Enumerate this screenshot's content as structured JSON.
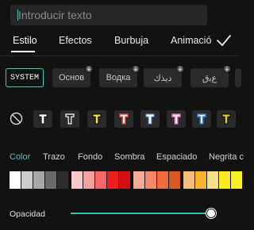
{
  "input": {
    "placeholder": "Introducir texto"
  },
  "tabs": [
    {
      "label": "Estilo"
    },
    {
      "label": "Efectos"
    },
    {
      "label": "Burbuja"
    },
    {
      "label": "Animació"
    }
  ],
  "fonts": [
    {
      "label": "SYSTEM"
    },
    {
      "label": "Основ"
    },
    {
      "label": "Водка"
    },
    {
      "label": "ديذك"
    },
    {
      "label": "ﻉﺑﻕ"
    }
  ],
  "subtabs": [
    {
      "label": "Color"
    },
    {
      "label": "Trazo"
    },
    {
      "label": "Fondo"
    },
    {
      "label": "Sombra"
    },
    {
      "label": "Espaciado"
    },
    {
      "label": "Negrita c"
    }
  ],
  "colors": {
    "accent": "#3ec8c8",
    "swatches": [
      "#ffffff",
      "#cccccc",
      "#a8a8a8",
      "#6a6a6a",
      "#2e2e2e",
      "#f8c7c7",
      "#f7a0a0",
      "#f76767",
      "#ef1d1d",
      "#d40f14",
      "#f3a996",
      "#f28a6a",
      "#f26a3a",
      "#d85a23",
      "#f5bc7a",
      "#f7b42f",
      "#f5e08a",
      "#f6ea22",
      "#f8f020"
    ]
  },
  "opacity": {
    "label": "Opacidad",
    "value": 1.0
  }
}
